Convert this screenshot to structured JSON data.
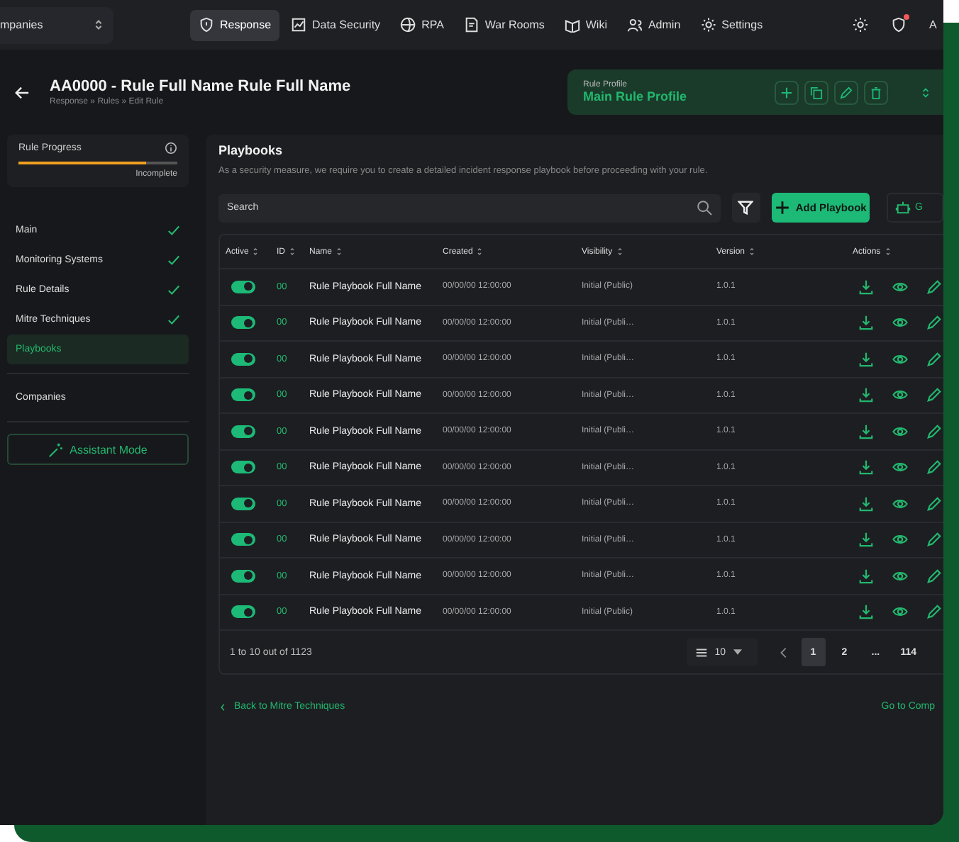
{
  "nav": {
    "company_select": "mpanies",
    "items": [
      {
        "label": "Response",
        "selected": true
      },
      {
        "label": "Data Security",
        "selected": false
      },
      {
        "label": "RPA",
        "selected": false
      },
      {
        "label": "War Rooms",
        "selected": false
      },
      {
        "label": "Wiki",
        "selected": false
      },
      {
        "label": "Admin",
        "selected": false
      },
      {
        "label": "Settings",
        "selected": false
      }
    ],
    "notification": true,
    "cut_item": "A"
  },
  "header": {
    "title": "AA0000 - Rule Full Name Rule Full Name",
    "breadcrumb": "Response » Rules » Edit Rule"
  },
  "profile": {
    "label": "Rule Profile",
    "name": "Main Rule Profile"
  },
  "progress": {
    "title": "Rule Progress",
    "level": 0.8,
    "status": "Incomplete"
  },
  "steps": [
    {
      "label": "Main",
      "done": true,
      "selected": false
    },
    {
      "label": "Monitoring Systems",
      "done": true,
      "selected": false
    },
    {
      "label": "Rule Details",
      "done": true,
      "selected": false
    },
    {
      "label": "Mitre Techniques",
      "done": true,
      "selected": false
    },
    {
      "label": "Playbooks",
      "done": false,
      "selected": true
    }
  ],
  "companies": "Companies",
  "assistant": "Assistant Mode",
  "panel": {
    "title": "Playbooks",
    "description": "As a security measure, we require you to create a detailed incident response playbook before proceeding with your rule.",
    "search": {
      "placeholder": "Search"
    },
    "add_button": "Add Playbook",
    "cut_button": "G"
  },
  "table": {
    "columns": [
      "Active",
      "ID",
      "Name",
      "Created",
      "Visibility",
      "Version",
      "Actions"
    ],
    "rows": [
      {
        "active": true,
        "id": "00",
        "name": "Rule Playbook Full Name",
        "created": "00/00/00 12:00:00",
        "visibility": "Initial (Public)",
        "version": "1.0.1"
      },
      {
        "active": true,
        "id": "00",
        "name": "Rule Playbook Full Name",
        "created": "00/00/00 12:00:00",
        "visibility": "Initial (Publi…",
        "version": "1.0.1"
      },
      {
        "active": true,
        "id": "00",
        "name": "Rule Playbook Full Name",
        "created": "00/00/00 12:00:00",
        "visibility": "Initial (Publi…",
        "version": "1.0.1"
      },
      {
        "active": true,
        "id": "00",
        "name": "Rule Playbook Full Name",
        "created": "00/00/00 12:00:00",
        "visibility": "Initial (Publi…",
        "version": "1.0.1"
      },
      {
        "active": true,
        "id": "00",
        "name": "Rule Playbook Full Name",
        "created": "00/00/00 12:00:00",
        "visibility": "Initial (Publi…",
        "version": "1.0.1"
      },
      {
        "active": true,
        "id": "00",
        "name": "Rule Playbook Full Name",
        "created": "00/00/00 12:00:00",
        "visibility": "Initial (Publi…",
        "version": "1.0.1"
      },
      {
        "active": true,
        "id": "00",
        "name": "Rule Playbook Full Name",
        "created": "00/00/00 12:00:00",
        "visibility": "Initial (Publi…",
        "version": "1.0.1"
      },
      {
        "active": true,
        "id": "00",
        "name": "Rule Playbook Full Name",
        "created": "00/00/00 12:00:00",
        "visibility": "Initial (Publi…",
        "version": "1.0.1"
      },
      {
        "active": true,
        "id": "00",
        "name": "Rule Playbook Full Name",
        "created": "00/00/00 12:00:00",
        "visibility": "Initial (Publi…",
        "version": "1.0.1"
      },
      {
        "active": true,
        "id": "00",
        "name": "Rule Playbook Full Name",
        "created": "00/00/00 12:00:00",
        "visibility": "Initial (Public)",
        "version": "1.0.1"
      }
    ]
  },
  "pagination": {
    "summary": "1 to 10 out of 1123",
    "page_size": "10",
    "pages": [
      {
        "label": "1",
        "selected": true
      },
      {
        "label": "2",
        "selected": false
      },
      {
        "label": "...",
        "selected": false
      },
      {
        "label": "114",
        "selected": false
      }
    ]
  },
  "footer": {
    "back": "Back to Mitre Techniques",
    "next": "Go to Comp"
  }
}
